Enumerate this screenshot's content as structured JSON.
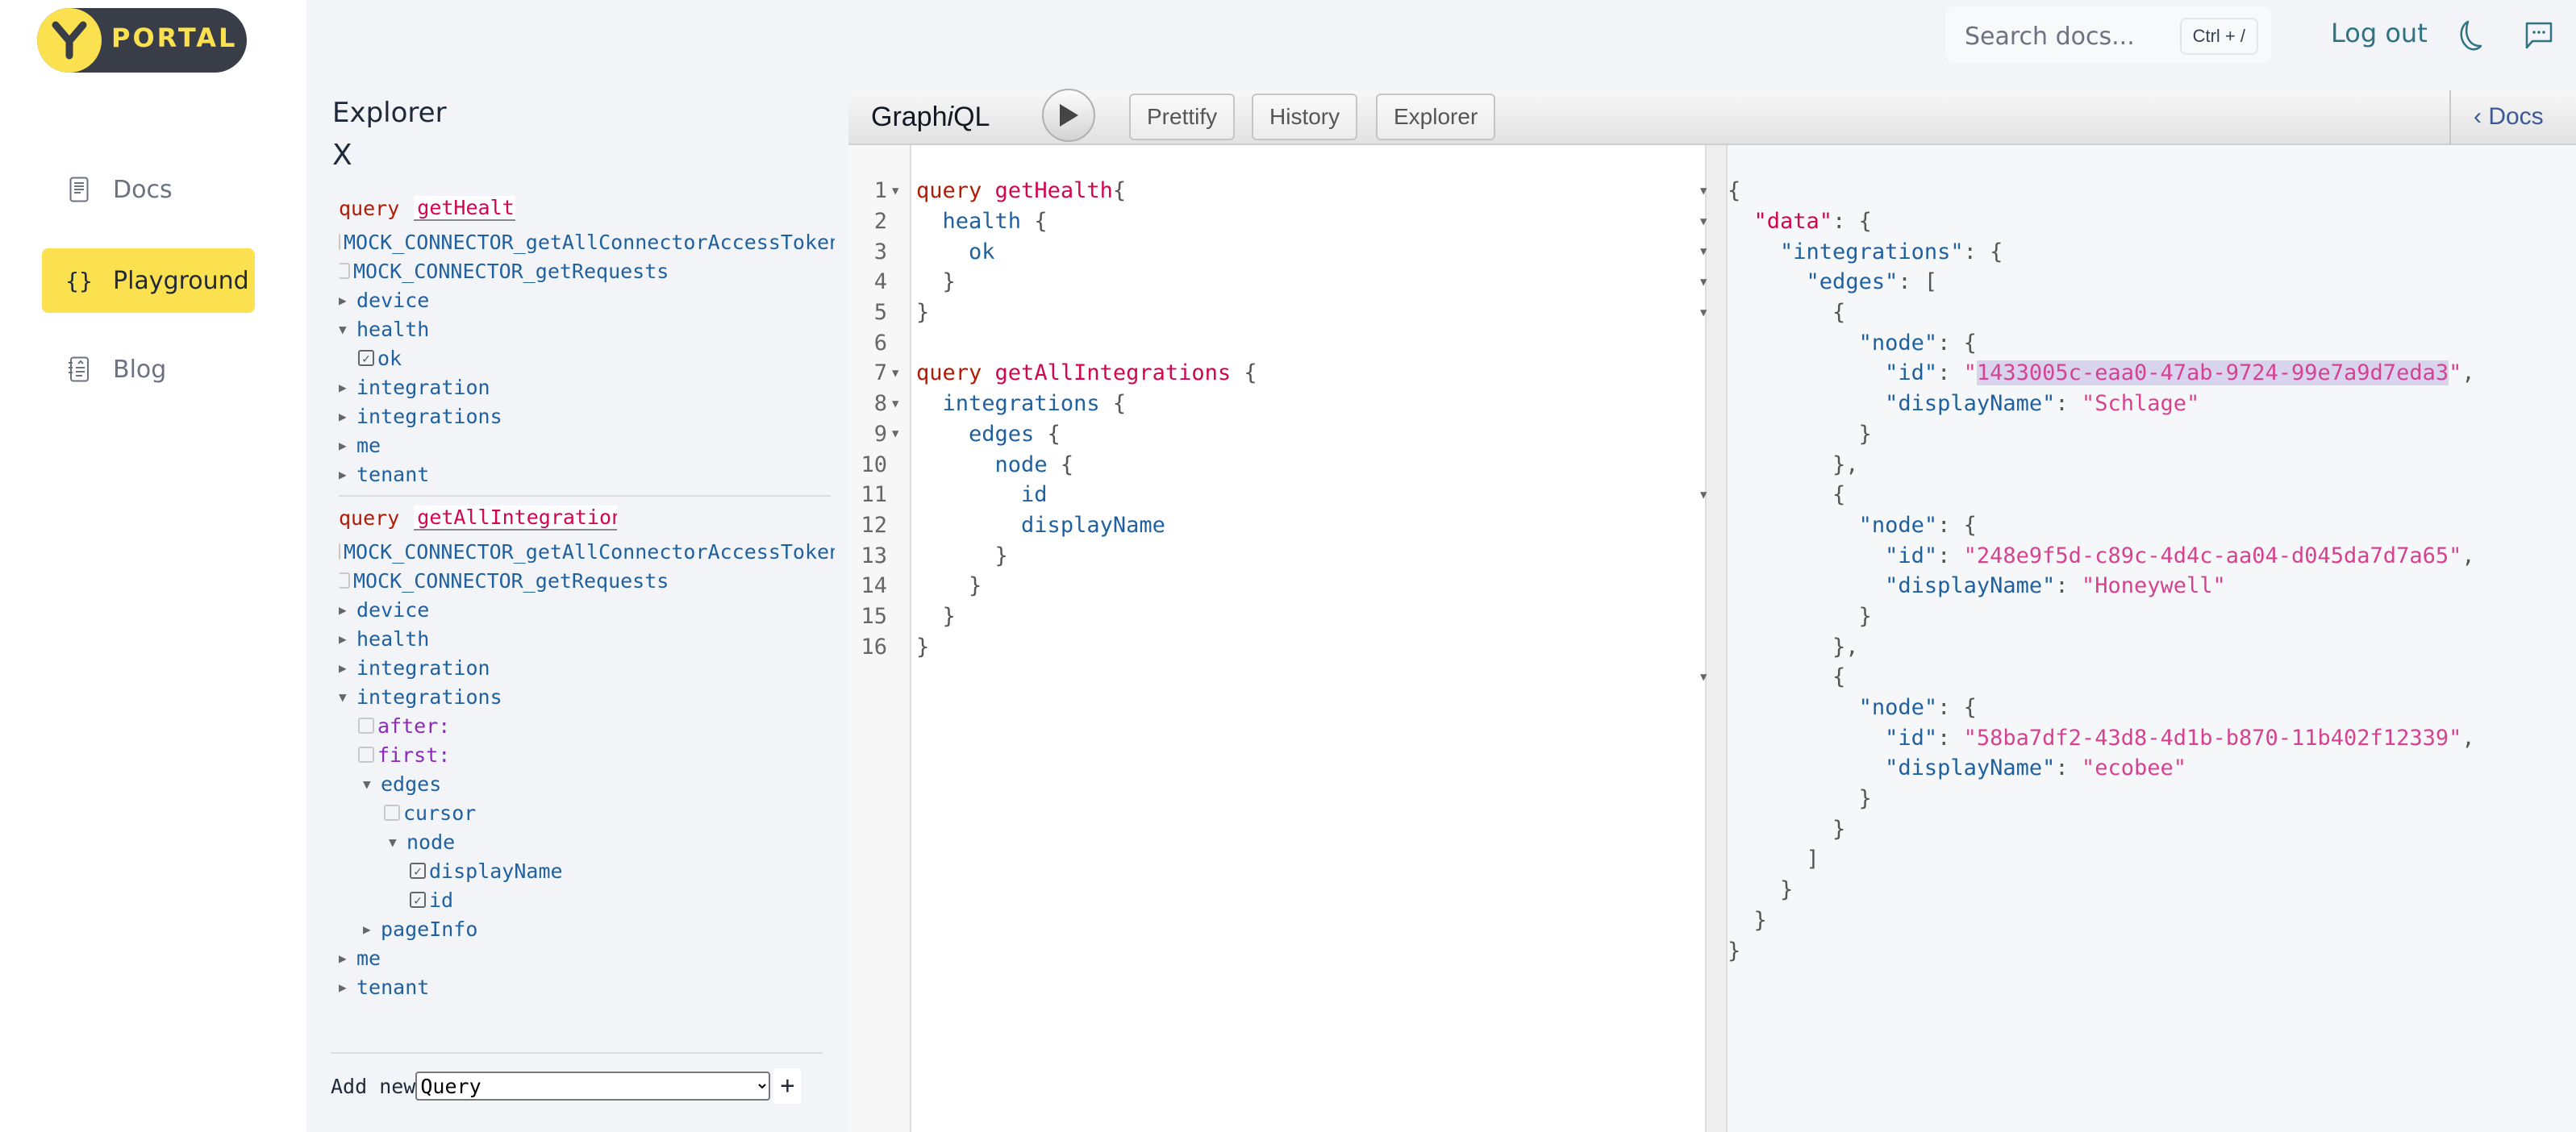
{
  "brand": {
    "logo_letter": "Y",
    "logo_text": "PORTAL",
    "accent": "#fbe04f",
    "dark": "#383d47"
  },
  "nav": {
    "items": [
      {
        "label": "Docs",
        "icon": "document-icon",
        "active": false
      },
      {
        "label": "Playground",
        "icon": "braces-icon",
        "active": true
      },
      {
        "label": "Blog",
        "icon": "blog-icon",
        "active": false
      }
    ]
  },
  "header": {
    "search_placeholder": "Search docs...",
    "search_shortcut": "Ctrl + /",
    "logout_label": "Log out",
    "theme_icon": "moon-icon",
    "feedback_icon": "chat-icon"
  },
  "explorer": {
    "title": "Explorer",
    "close_label": "X",
    "operations": [
      {
        "keyword": "query",
        "name": "getHealth",
        "mock_fields": [
          "MOCK_CONNECTOR_getAllConnectorAccessTokens",
          "MOCK_CONNECTOR_getRequests"
        ],
        "fields": [
          "device",
          "health",
          "ok",
          "integration",
          "integrations",
          "me",
          "tenant"
        ]
      },
      {
        "keyword": "query",
        "name": "getAllIntegrations",
        "mock_fields": [
          "MOCK_CONNECTOR_getAllConnectorAccessTokens",
          "MOCK_CONNECTOR_getRequests"
        ],
        "fields": [
          "device",
          "health",
          "integration",
          "integrations",
          "after:",
          "first:",
          "edges",
          "cursor",
          "node",
          "displayName",
          "id",
          "pageInfo",
          "me",
          "tenant"
        ]
      }
    ],
    "add_new_label": "Add new",
    "add_new_selected": "Query",
    "add_new_plus": "+"
  },
  "graphiql": {
    "title_prefix": "Graph",
    "title_italic": "i",
    "title_suffix": "QL",
    "run_icon": "play-icon",
    "buttons": {
      "prettify": "Prettify",
      "history": "History",
      "explorer": "Explorer"
    },
    "docs_label": "Docs"
  },
  "query_editor": {
    "lines": [
      {
        "n": "1",
        "fold": true
      },
      {
        "n": "2"
      },
      {
        "n": "3"
      },
      {
        "n": "4"
      },
      {
        "n": "5"
      },
      {
        "n": "6"
      },
      {
        "n": "7",
        "fold": true
      },
      {
        "n": "8",
        "fold": true
      },
      {
        "n": "9",
        "fold": true
      },
      {
        "n": "10"
      },
      {
        "n": "11"
      },
      {
        "n": "12"
      },
      {
        "n": "13"
      },
      {
        "n": "14"
      },
      {
        "n": "15"
      },
      {
        "n": "16"
      }
    ],
    "tokens": {
      "query": "query",
      "getHealth": "getHealth",
      "health": "health",
      "ok": "ok",
      "getAllIntegrations": "getAllIntegrations",
      "integrations": "integrations",
      "edges": "edges",
      "node": "node",
      "id": "id",
      "displayName": "displayName"
    }
  },
  "results": {
    "data_key": "\"data\"",
    "integrations_key": "\"integrations\"",
    "edges_key": "\"edges\"",
    "node_key": "\"node\"",
    "id_key": "\"id\"",
    "displayName_key": "\"displayName\"",
    "edges": [
      {
        "id": "1433005c-eaa0-47ab-9724-99e7a9d7eda3",
        "displayName": "Schlage"
      },
      {
        "id": "248e9f5d-c89c-4d4c-aa04-d045da7d7a65",
        "displayName": "Honeywell"
      },
      {
        "id": "58ba7df2-43d8-4d1b-b870-11b402f12339",
        "displayName": "ecobee"
      }
    ]
  }
}
